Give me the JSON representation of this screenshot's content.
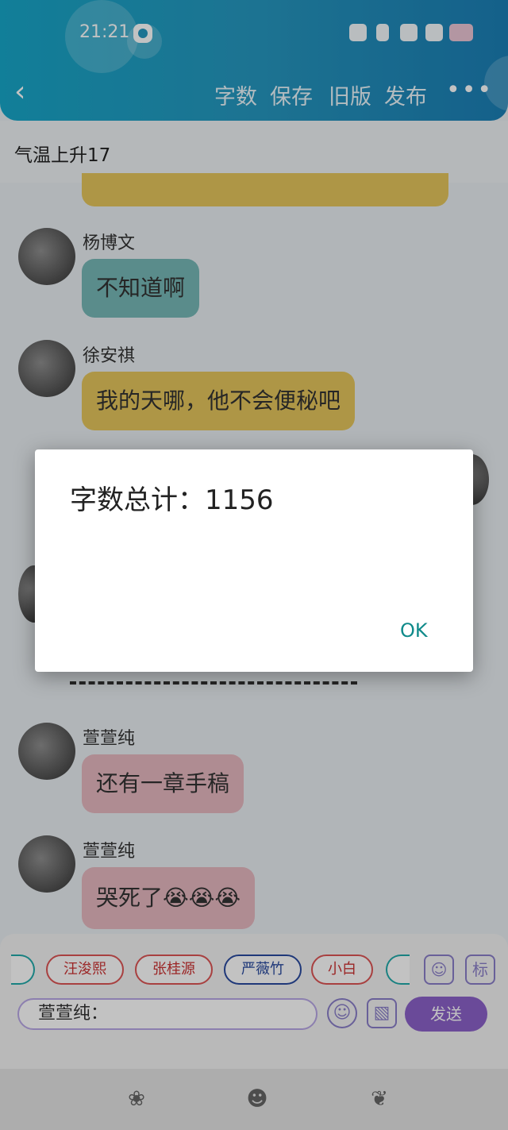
{
  "status_bar": {
    "time": "21:21"
  },
  "header": {
    "back_icon": "chevron-left-icon",
    "actions": [
      "字数",
      "保存",
      "旧版",
      "发布"
    ],
    "more_icon": "more-horizontal-icon"
  },
  "title": "气温上升17",
  "messages": [
    {
      "name": "杨博文",
      "text": "不知道啊",
      "color": "#77b9b7"
    },
    {
      "name": "徐安祺",
      "text": "我的天哪，他不会便秘吧",
      "color": "#e5c65c"
    },
    {
      "name": "萱萱纯",
      "text": "还有一章手稿",
      "color": "#e7b8c0"
    },
    {
      "name": "萱萱纯",
      "text": "哭死了😭😭😭",
      "color": "#e7b8c0"
    }
  ],
  "dialog": {
    "message": "字数总计：1156",
    "ok_label": "OK"
  },
  "composer": {
    "chips": [
      "汪浚熙",
      "张桂源",
      "严薇竹",
      "小白"
    ],
    "label_button": "标",
    "input_value": "萱萱纯：",
    "send_label": "发送"
  },
  "colors": {
    "header_gradient_start": "#17a7c9",
    "header_gradient_end": "#1b7fb6",
    "send_button": "#8c62c9",
    "dialog_ok": "#0f8a8a"
  }
}
